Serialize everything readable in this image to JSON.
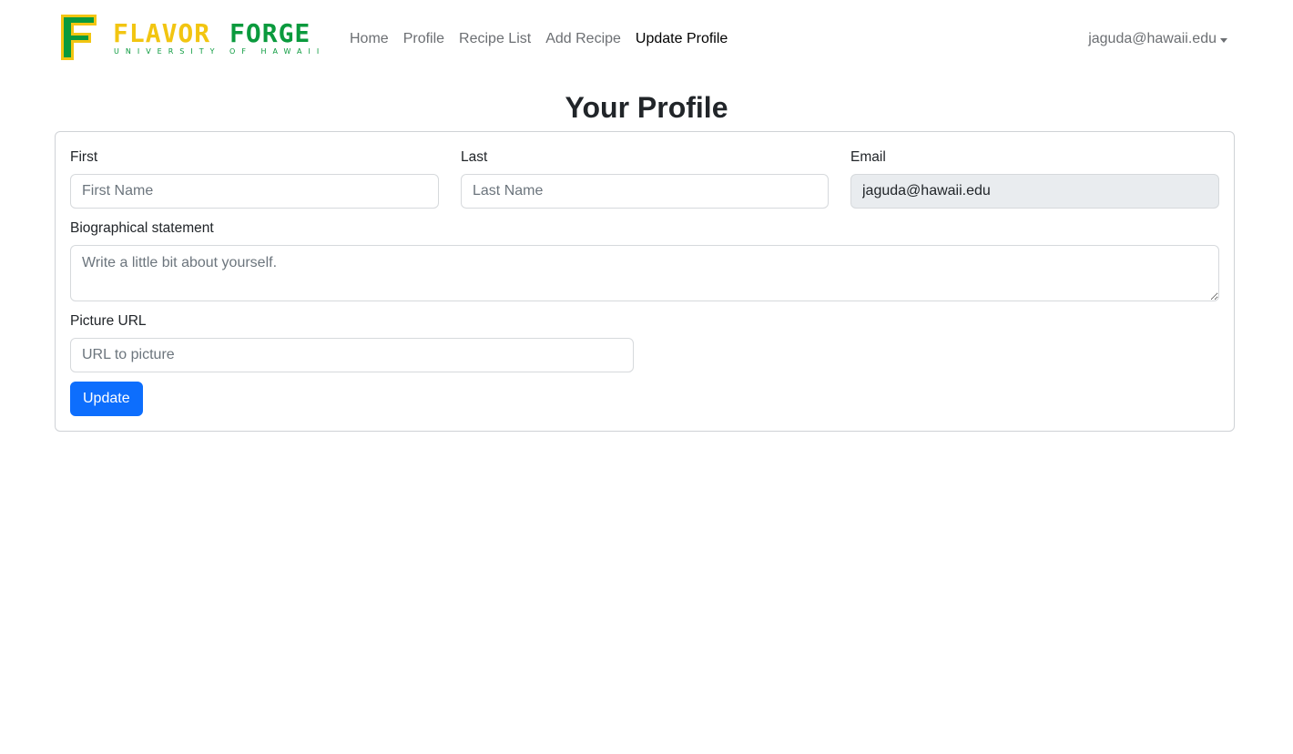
{
  "brand": {
    "logo_letter": "F",
    "logo_word1": "FLAVOR",
    "logo_word2": "FORGE",
    "logo_tagline": "UNIVERSITY OF HAWAII",
    "colors": {
      "green": "#0a9a3d",
      "yellow": "#f2c511"
    }
  },
  "nav": {
    "home": "Home",
    "profile": "Profile",
    "recipe_list": "Recipe List",
    "add_recipe": "Add Recipe",
    "update_profile": "Update Profile",
    "active": "Update Profile",
    "user": "jaguda@hawaii.edu"
  },
  "page": {
    "title": "Your Profile"
  },
  "form": {
    "first": {
      "label": "First",
      "placeholder": "First Name",
      "value": ""
    },
    "last": {
      "label": "Last",
      "placeholder": "Last Name",
      "value": ""
    },
    "email": {
      "label": "Email",
      "value": "jaguda@hawaii.edu"
    },
    "bio": {
      "label": "Biographical statement",
      "placeholder": "Write a little bit about yourself.",
      "value": ""
    },
    "picture": {
      "label": "Picture URL",
      "placeholder": "URL to picture",
      "value": ""
    },
    "submit_label": "Update"
  },
  "colors": {
    "primary": "#0d6efd",
    "readonly_bg": "#e9ecef"
  }
}
